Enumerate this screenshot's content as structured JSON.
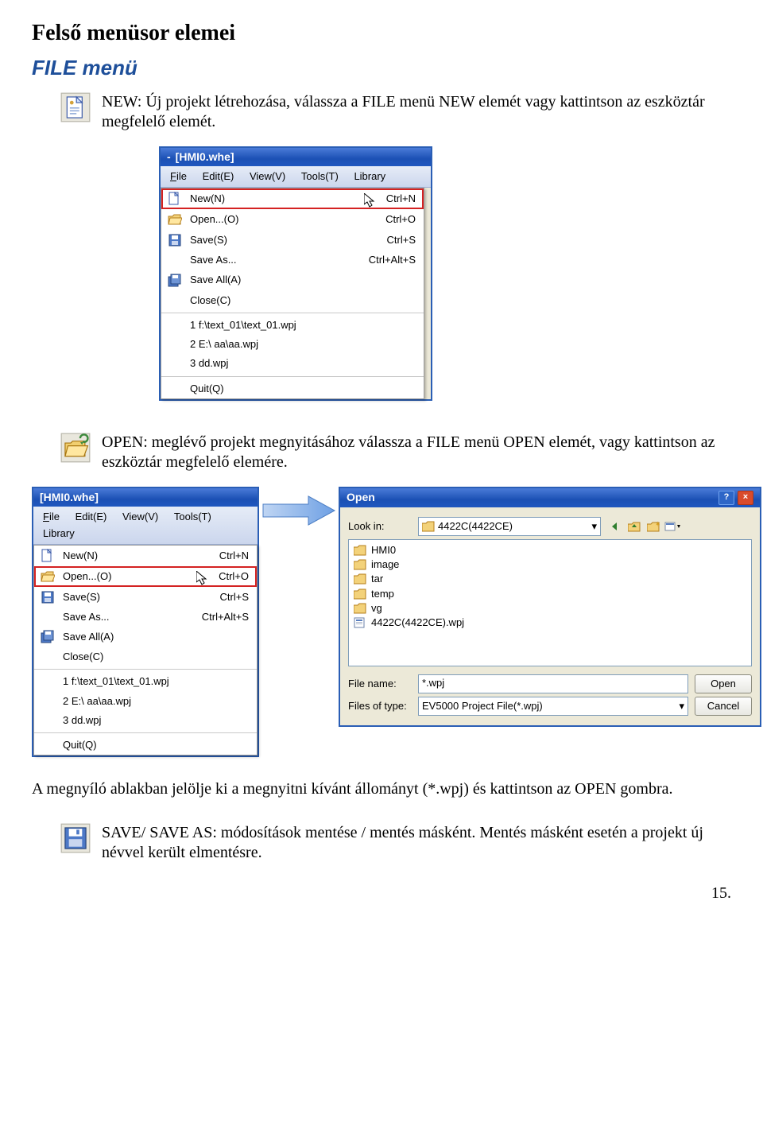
{
  "heading": "Felső menüsor elemei",
  "subheading": "FILE menü",
  "entry_new": "NEW: Új projekt létrehozása, válassza a FILE menü NEW elemét vagy kattintson az eszköztár megfelelő elemét.",
  "entry_open": "OPEN: meglévő projekt megnyitásához válassza a FILE menü OPEN elemét, vagy kattintson az eszköztár megfelelő elemére.",
  "para_open_note": "A megnyíló ablakban jelölje ki a megnyitni kívánt állományt (*.wpj) és kattintson az OPEN gombra.",
  "entry_save": "SAVE/ SAVE AS: módosítások mentése / mentés másként. Mentés másként esetén a projekt új névvel került elmentésre.",
  "page_number": "15.",
  "win_title": "[HMI0.whe]",
  "menubar": {
    "file": "File",
    "edit": "Edit(E)",
    "view": "View(V)",
    "tools": "Tools(T)",
    "library": "Library"
  },
  "menu": {
    "new": {
      "label": "New(N)",
      "shortcut": "Ctrl+N"
    },
    "open": {
      "label": "Open...(O)",
      "shortcut": "Ctrl+O"
    },
    "save": {
      "label": "Save(S)",
      "shortcut": "Ctrl+S"
    },
    "saveas": {
      "label": "Save As...",
      "shortcut": "Ctrl+Alt+S"
    },
    "saveall": {
      "label": "Save All(A)",
      "shortcut": ""
    },
    "close": {
      "label": "Close(C)",
      "shortcut": ""
    },
    "recent1": {
      "label": "1 f:\\text_01\\text_01.wpj"
    },
    "recent2": {
      "label": "2 E:\\ aa\\aa.wpj"
    },
    "recent3": {
      "label": "3 dd.wpj"
    },
    "quit": {
      "label": "Quit(Q)"
    }
  },
  "open_dialog": {
    "title": "Open",
    "lookin_label": "Look in:",
    "lookin_value": "4422C(4422CE)",
    "files": [
      "HMI0",
      "image",
      "tar",
      "temp",
      "vg",
      "4422C(4422CE).wpj"
    ],
    "filename_label": "File name:",
    "filename_value": "*.wpj",
    "filetype_label": "Files of type:",
    "filetype_value": "EV5000 Project File(*.wpj)",
    "open_btn": "Open",
    "cancel_btn": "Cancel"
  }
}
